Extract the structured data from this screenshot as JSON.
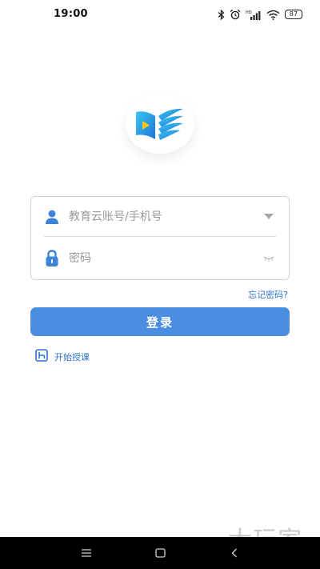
{
  "status_bar": {
    "time": "19:00",
    "battery": "87",
    "icons": [
      "bluetooth-icon",
      "alarm-icon",
      "hd-signal-icon",
      "wifi-icon",
      "battery-icon"
    ]
  },
  "login": {
    "account_placeholder": "教育云账号/手机号",
    "password_placeholder": "密码",
    "forgot_password": "忘记密码?",
    "submit_label": "登录"
  },
  "start_teaching": {
    "label": "开始授课"
  },
  "watermark": "大玩家",
  "colors": {
    "primary": "#4a8ee0",
    "link": "#2e73c9",
    "border": "#cfd3d9",
    "placeholder": "#9a9a9a"
  }
}
